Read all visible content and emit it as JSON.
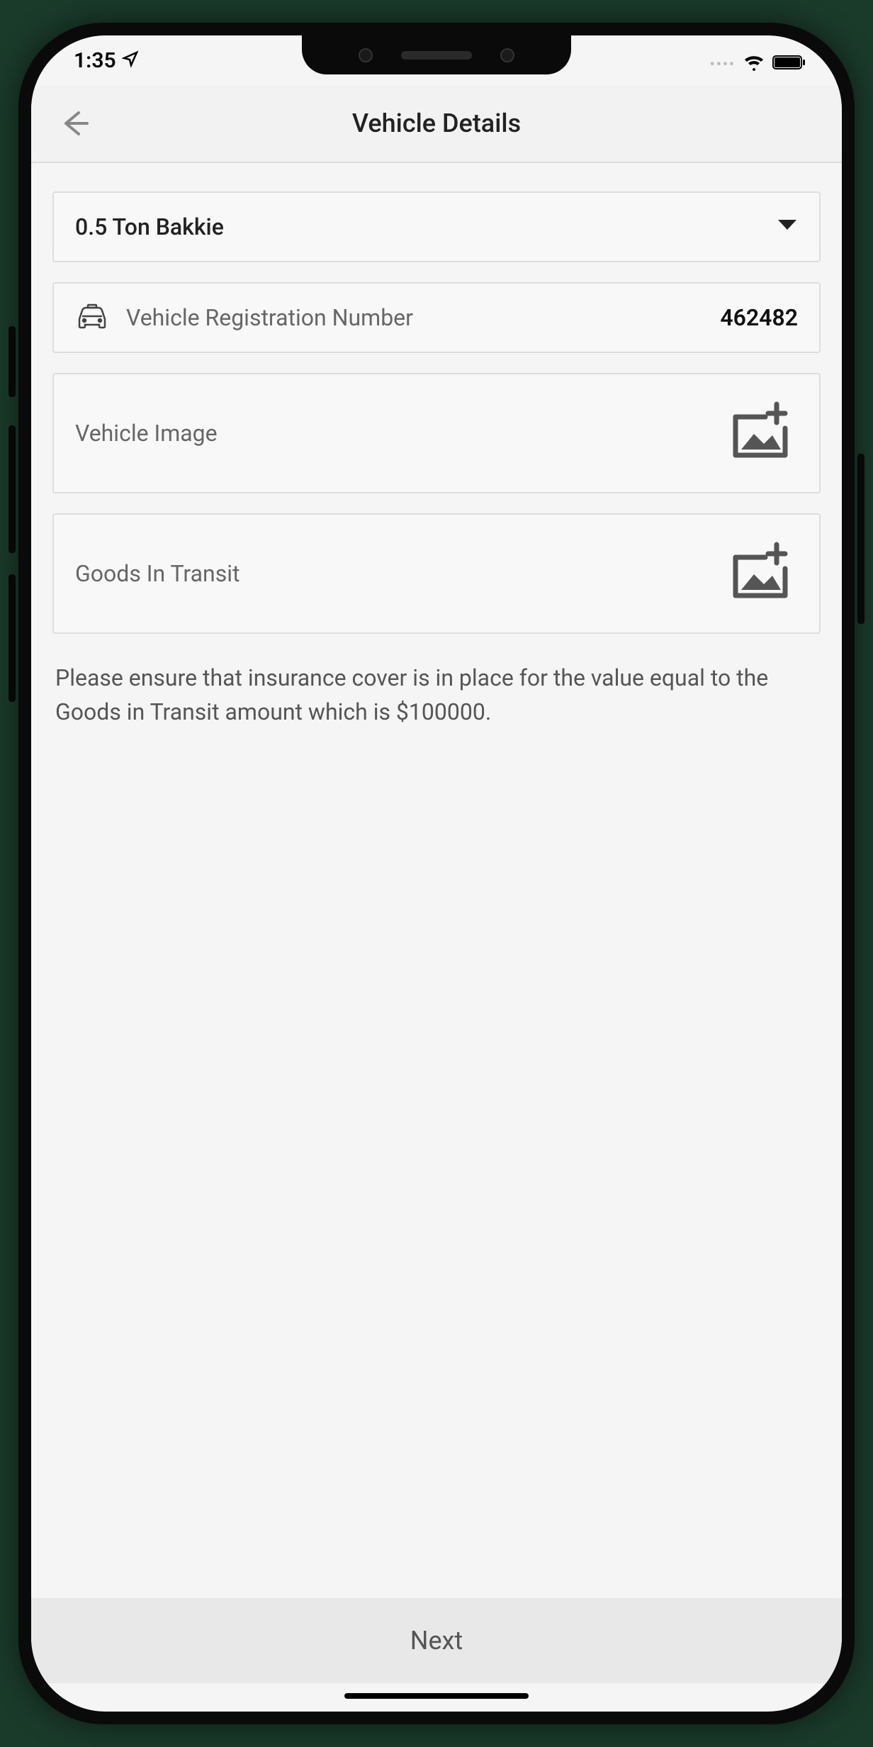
{
  "status": {
    "time": "1:35"
  },
  "header": {
    "title": "Vehicle Details"
  },
  "form": {
    "vehicle_type": "0.5 Ton Bakkie",
    "reg_label": "Vehicle Registration Number",
    "reg_value": "462482",
    "vehicle_image_label": "Vehicle Image",
    "goods_transit_label": "Goods In Transit",
    "info_text": "Please ensure that insurance cover is in place for the value equal to the Goods in Transit amount which is $100000."
  },
  "footer": {
    "next_label": "Next"
  }
}
